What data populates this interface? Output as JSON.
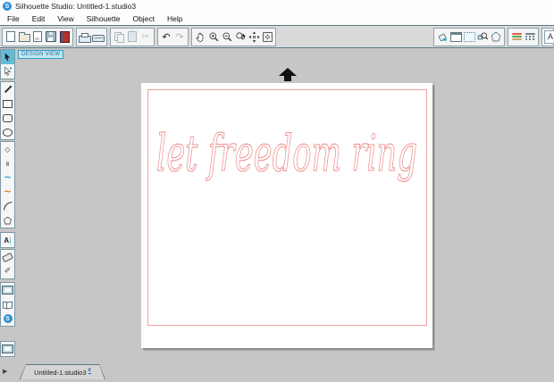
{
  "window": {
    "title": "Silhouette Studio: Untitled-1.studio3",
    "logo_letter": "S"
  },
  "menu": {
    "items": [
      "File",
      "Edit",
      "View",
      "Silhouette",
      "Object",
      "Help"
    ]
  },
  "toolbar": {
    "file_group": [
      "new-document",
      "open",
      "save",
      "save-to-library",
      "library"
    ],
    "output_group": [
      "print",
      "send-to-silhouette"
    ],
    "edit_group": [
      "copy",
      "paste",
      "cut"
    ],
    "history_group": [
      "undo",
      "redo"
    ],
    "view_group": [
      "pan",
      "zoom-in",
      "zoom-out",
      "zoom-selection",
      "drag-zoom",
      "fit-to-page"
    ],
    "panel_group": [
      "fill",
      "page-setup",
      "grid",
      "trace",
      "cut-settings"
    ],
    "style_group": [
      "line-color",
      "line-style"
    ],
    "text_group": [
      "text-style"
    ]
  },
  "glyphs": {
    "scissors": "✂",
    "undo": "↶",
    "redo": "↷",
    "letter_a": "A",
    "caret": "|",
    "knife": "✐",
    "curve": "∞",
    "wave": "~",
    "polygon": "◇",
    "expand_arrow": "▶",
    "store_letter": "S"
  },
  "sidebar": {
    "tools": [
      "select",
      "point-editing",
      "draw-line",
      "draw-rectangle",
      "draw-rounded-rectangle",
      "draw-ellipse",
      "draw-polygon",
      "draw-curve",
      "freehand",
      "smooth-freehand",
      "draw-arc",
      "draw-regular-polygon",
      "text",
      "eraser",
      "knife",
      "design-view",
      "library",
      "silhouette-store",
      "preview",
      "expand"
    ]
  },
  "canvas": {
    "view_badge": "DESIGN VIEW",
    "background": "#c6c6c6",
    "page_border_color": "#f2a29d"
  },
  "artwork": {
    "text": "let freedom ring",
    "stroke_color": "#ef8f8f"
  },
  "tabbar": {
    "active_tab": "Untitled-1.studio3",
    "close": "x"
  }
}
